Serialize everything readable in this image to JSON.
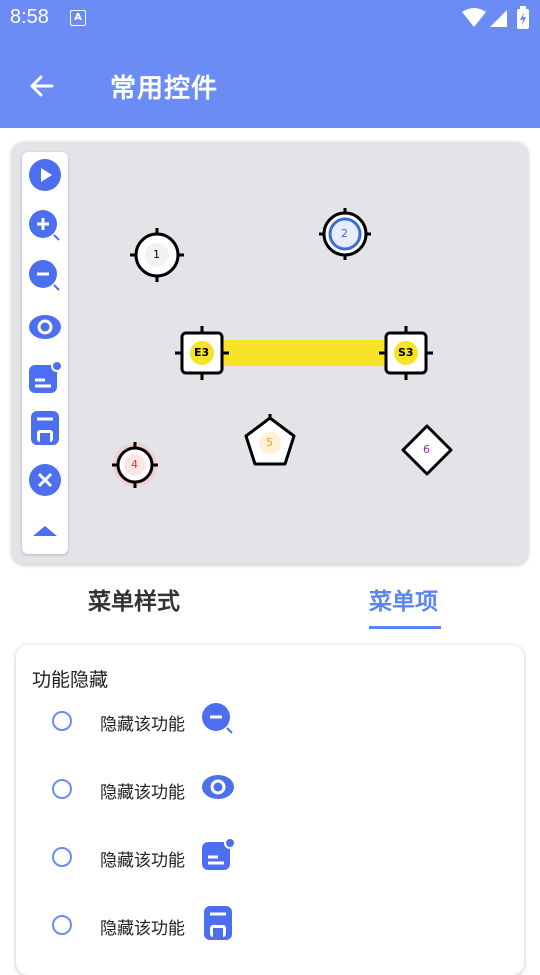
{
  "status_bar": {
    "time": "8:58",
    "notif_icon_letter": "A"
  },
  "app_bar": {
    "title": "常用控件"
  },
  "toolbar": {
    "tools": [
      "play-icon",
      "zoom-in-icon",
      "zoom-out-icon",
      "eye-icon",
      "note-badge-icon",
      "card-icon",
      "close-icon",
      "collapse-up-icon"
    ]
  },
  "canvas": {
    "markers": [
      {
        "label": "1",
        "shape": "circle",
        "color": "#000000"
      },
      {
        "label": "2",
        "shape": "circle",
        "color": "#3b6fd8"
      },
      {
        "label": "4",
        "shape": "circle",
        "color": "#d23a3a"
      },
      {
        "label": "5",
        "shape": "pentagon",
        "color": "#e8a130"
      },
      {
        "label": "6",
        "shape": "diamond",
        "color": "#a020c8"
      }
    ],
    "link": {
      "start_label": "E3",
      "end_label": "S3",
      "bar_color": "#f7e227"
    }
  },
  "tabs": [
    {
      "label": "菜单样式",
      "selected": false
    },
    {
      "label": "菜单项",
      "selected": true
    }
  ],
  "panel": {
    "heading": "功能隐藏",
    "options": [
      {
        "label": "隐藏该功能",
        "icon": "zoom-out-icon"
      },
      {
        "label": "隐藏该功能",
        "icon": "eye-icon"
      },
      {
        "label": "隐藏该功能",
        "icon": "note-badge-icon"
      },
      {
        "label": "隐藏该功能",
        "icon": "card-icon"
      }
    ]
  },
  "colors": {
    "primary": "#6b8cf5",
    "icon_blue": "#4c6ff0",
    "canvas_bg": "#e3e3e8"
  }
}
